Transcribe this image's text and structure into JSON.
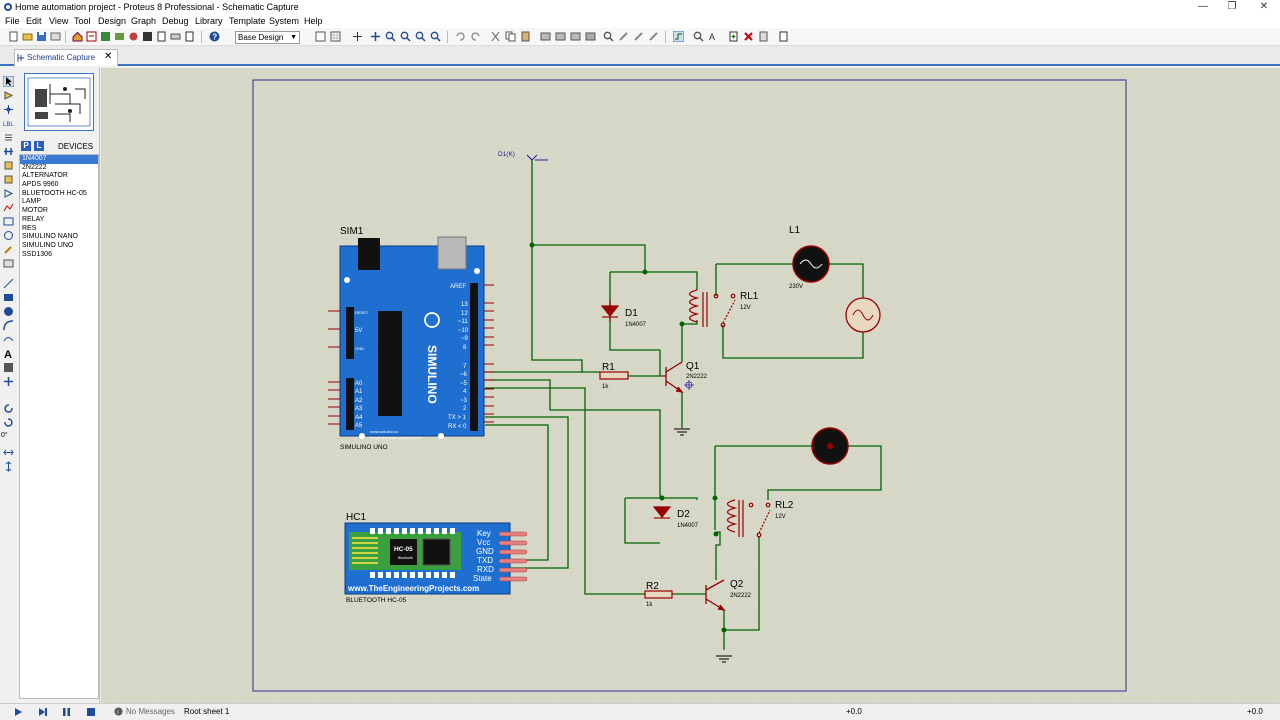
{
  "window": {
    "title": "Home automation project - Proteus 8 Professional - Schematic Capture",
    "minimize": "—",
    "maximize": "❐",
    "close": "✕"
  },
  "menu": [
    "File",
    "Edit",
    "View",
    "Tool",
    "Design",
    "Graph",
    "Debug",
    "Library",
    "Template",
    "System",
    "Help"
  ],
  "toolbar": {
    "layer": "Base Design"
  },
  "tab": {
    "label": "Schematic Capture"
  },
  "picker": {
    "p": "P",
    "l": "L",
    "title": "DEVICES"
  },
  "devices": [
    "1N4007",
    "2N2222",
    "ALTERNATOR",
    "APDS 9960",
    "BLUETOOTH HC-05",
    "LAMP",
    "MOTOR",
    "RELAY",
    "RES",
    "SIMULINO NANO",
    "SIMULINO UNO",
    "SSD1306"
  ],
  "selected_device": "1N4007",
  "rotation": "0°",
  "schematic": {
    "probe": "D1(K)",
    "sim1": {
      "ref": "SIM1",
      "value": "SIMULINO UNO",
      "brand": "SIMULINO",
      "url1": "www.arduino.cc",
      "url2": "blogembarcado.blogspot.com",
      "aref": "AREF",
      "pins_right": [
        "13",
        "12",
        "~11",
        "~10",
        "~9",
        "8",
        "7",
        "~6",
        "~5",
        "4",
        "~3",
        "2",
        "TX > 1",
        "RX < 0"
      ],
      "pins_left_top": [
        "RESET",
        "5V",
        "GND"
      ],
      "pins_left_bottom": [
        "A0",
        "A1",
        "A2",
        "A3",
        "A4",
        "A5"
      ]
    },
    "hc1": {
      "ref": "HC1",
      "value": "BLUETOOTH HC-05",
      "chip": "HC-05",
      "chip_sub": "Bluetooth",
      "pins": [
        "Key",
        "Vcc",
        "GND",
        "TXD",
        "RXD",
        "State"
      ],
      "footer": "www.TheEngineeringProjects.com"
    },
    "d1": {
      "ref": "D1",
      "value": "1N4007"
    },
    "d2": {
      "ref": "D2",
      "value": "1N4007"
    },
    "q1": {
      "ref": "Q1",
      "value": "2N2222"
    },
    "q2": {
      "ref": "Q2",
      "value": "2N2222"
    },
    "r1": {
      "ref": "R1",
      "value": "1k"
    },
    "r2": {
      "ref": "R2",
      "value": "1k"
    },
    "rl1": {
      "ref": "RL1",
      "value": "12V"
    },
    "rl2": {
      "ref": "RL2",
      "value": "12V"
    },
    "l1": {
      "ref": "L1",
      "value": "230V"
    }
  },
  "status": {
    "messages": "No Messages",
    "sheet": "Root sheet 1",
    "coord_x": "+0.0",
    "coord_y": "+0.0"
  },
  "colors": {
    "canvas": "#d8d8c8",
    "grid": "#c8c8b8",
    "wire": "#006400",
    "component": "#9a0000",
    "sheet_border": "#2c2c9c",
    "board": "#1f6fd0",
    "accent": "#3c74c4"
  }
}
